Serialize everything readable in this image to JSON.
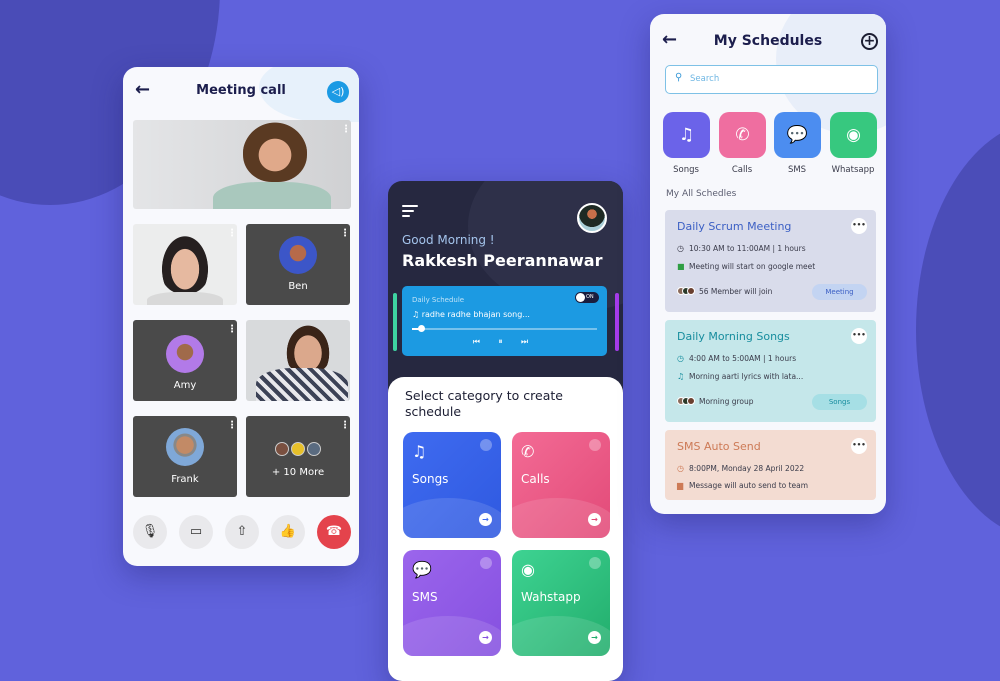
{
  "colors": {
    "background": "#6062dc",
    "accent_blue": "#1c9ae2",
    "end_call": "#e4434c",
    "songs": "#3f6bf0",
    "calls": "#ef5e8c",
    "sms": "#9159e6",
    "whatsapp": "#2fc381"
  },
  "meeting_call": {
    "title": "Meeting call",
    "back_icon": "arrow-left",
    "speaker_icon": "speaker",
    "participants": [
      {
        "name": "",
        "type": "video"
      },
      {
        "name": "",
        "type": "video"
      },
      {
        "name": "Ben",
        "type": "avatar"
      },
      {
        "name": "Amy",
        "type": "avatar"
      },
      {
        "name": "",
        "type": "video"
      },
      {
        "name": "Frank",
        "type": "avatar"
      }
    ],
    "more_label": "+ 10 More",
    "more_icon": "⋮",
    "controls": [
      "🎙",
      "▭◂",
      "⇧",
      "👍",
      "☎"
    ]
  },
  "home": {
    "greeting": "Good Morning !",
    "user_name": "Rakkesh Peerannawar",
    "daily_schedule": {
      "label": "Daily Schedule",
      "toggle": "ON",
      "song": "♫ radhe radhe bhajan song...",
      "progress": 0.05,
      "controls": "⏮ ⏸ ⏭"
    },
    "section_title": "Select category to create schedule",
    "categories": [
      {
        "name": "Songs",
        "icon": "♫"
      },
      {
        "name": "Calls",
        "icon": "✆"
      },
      {
        "name": "SMS",
        "icon": "💬"
      },
      {
        "name": "Wahstapp",
        "icon": "◉"
      }
    ],
    "arrow_icon": "→"
  },
  "schedules": {
    "title": "My Schedules",
    "search_placeholder": "Search",
    "search_icon": "⚲",
    "quick_categories": [
      {
        "name": "Songs",
        "icon": "♫"
      },
      {
        "name": "Calls",
        "icon": "✆"
      },
      {
        "name": "SMS",
        "icon": "💬"
      },
      {
        "name": "Whatsapp",
        "icon": "◉"
      }
    ],
    "section_label": "My All Schedles",
    "cards": [
      {
        "title": "Daily Scrum Meeting",
        "time": "10:30 AM to 11:00AM |  1 hours",
        "detail": "Meeting will start on google meet",
        "group": "56 Member will join",
        "tag": "Meeting"
      },
      {
        "title": "Daily Morning Songs",
        "time": "4:00 AM to 5:00AM |  1 hours",
        "detail": "Morning aarti lyrics with lata...",
        "group": "Morning group",
        "tag": "Songs"
      },
      {
        "title": "SMS Auto Send",
        "time": "8:00PM, Monday 28 April 2022",
        "detail": "Message will auto send to team"
      }
    ],
    "more_icon": "•••",
    "clock_icon": "◷"
  }
}
